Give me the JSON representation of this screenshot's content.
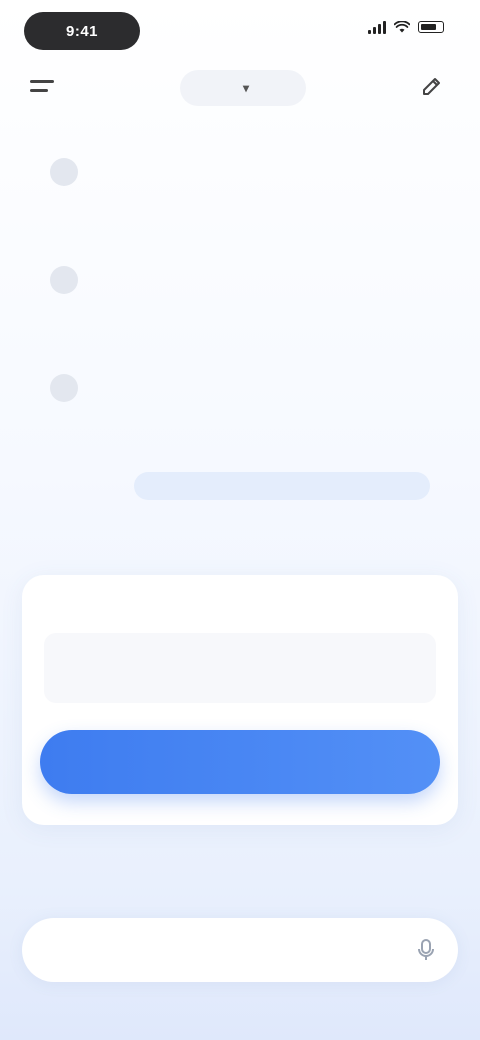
{
  "status_bar": {
    "time": "9:41"
  },
  "header": {
    "title": "",
    "icons": {
      "menu": "menu-icon",
      "dropdown": "chevron-down-icon",
      "new_chat": "new-chat-icon"
    }
  },
  "messages": [
    {
      "avatar": "",
      "text": ""
    },
    {
      "avatar": "",
      "text": ""
    },
    {
      "avatar": "",
      "text": ""
    }
  ],
  "user_message": {
    "text": ""
  },
  "composer": {
    "label": "",
    "value": "",
    "button_label": ""
  },
  "bottom_field": {
    "placeholder": ""
  },
  "colors": {
    "accent": "#3e7cf0",
    "user_bubble": "#e4edfc",
    "background_bottom": "#dfe8fb"
  }
}
